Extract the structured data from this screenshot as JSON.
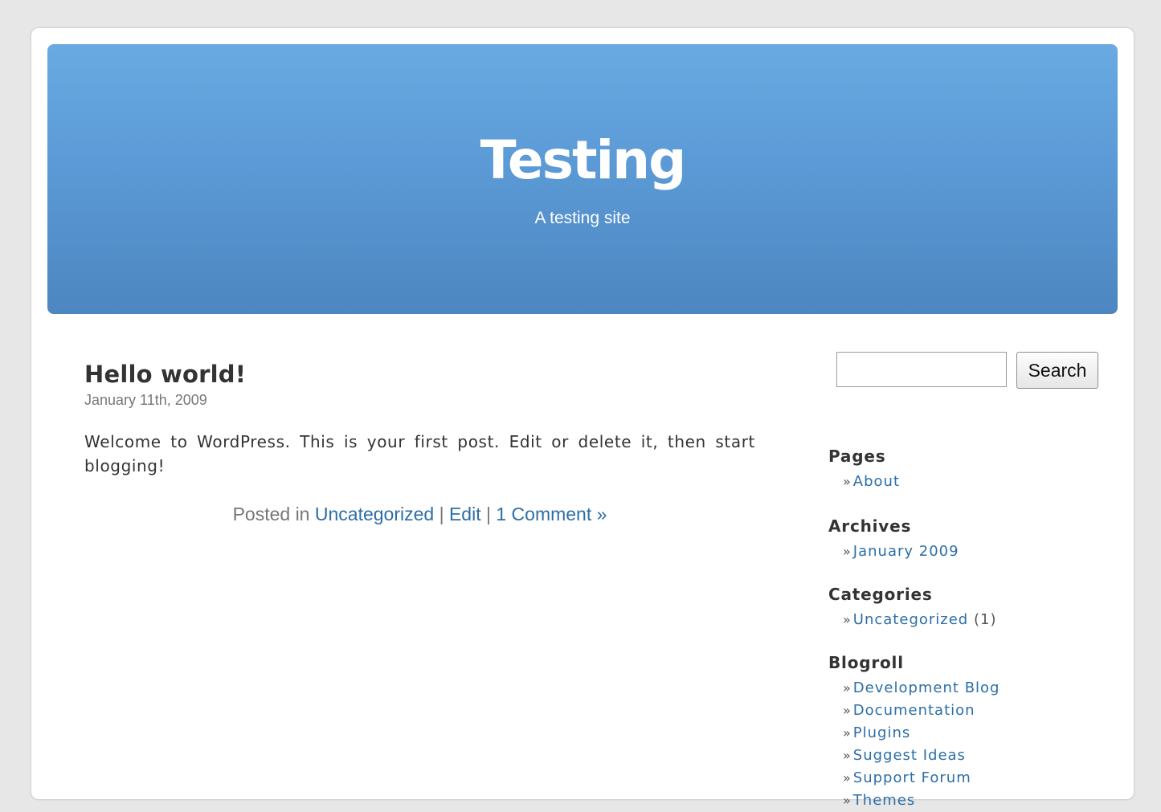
{
  "header": {
    "site_title": "Testing",
    "site_description": "A testing site"
  },
  "post": {
    "title": "Hello world!",
    "date": "January 11th, 2009",
    "body": "Welcome to WordPress. This is your first post. Edit or delete it, then start blogging!",
    "meta": {
      "posted_in_prefix": "Posted in",
      "category": "Uncategorized",
      "separator": "|",
      "edit": "Edit",
      "comments": "1 Comment »"
    }
  },
  "sidebar": {
    "search": {
      "value": "",
      "button_label": "Search"
    },
    "bullet": "»",
    "pages": {
      "title": "Pages",
      "items": [
        "About"
      ]
    },
    "archives": {
      "title": "Archives",
      "items": [
        "January 2009"
      ]
    },
    "categories": {
      "title": "Categories",
      "items": [
        {
          "label": "Uncategorized",
          "count": "(1)"
        }
      ]
    },
    "blogroll": {
      "title": "Blogroll",
      "items": [
        "Development Blog",
        "Documentation",
        "Plugins",
        "Suggest Ideas",
        "Support Forum",
        "Themes"
      ]
    }
  },
  "colors": {
    "header_top": "#69aae2",
    "header_bottom": "#4d86c0",
    "link": "#2c6ea6",
    "text": "#333333",
    "muted": "#777777",
    "background": "#e7e7e7"
  }
}
